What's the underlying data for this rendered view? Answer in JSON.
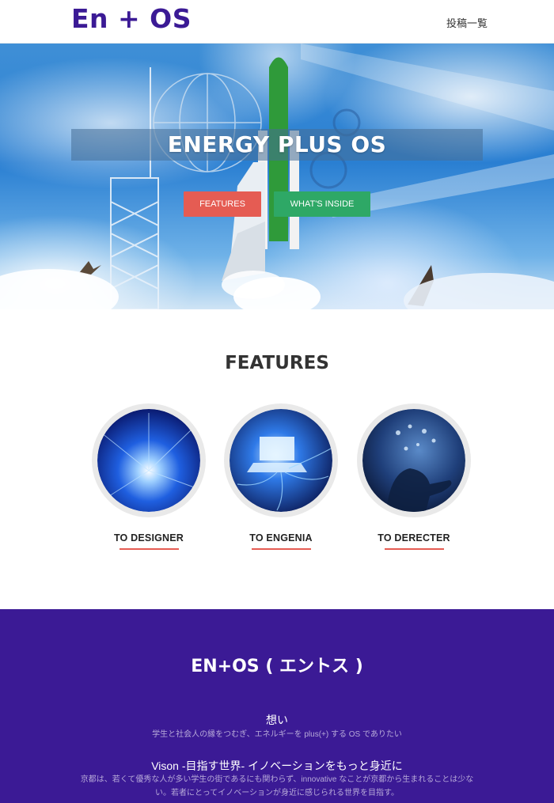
{
  "nav": {
    "brand": "En + OS",
    "link_posts": "投稿一覧"
  },
  "hero": {
    "title": "ENERGY PLUS OS",
    "btn_features": "FEATURES",
    "btn_inside": "WHAT'S INSIDE"
  },
  "features": {
    "title": "FEATURES",
    "items": [
      {
        "label": "TO DESIGNER"
      },
      {
        "label": "TO ENGENIA"
      },
      {
        "label": "TO DERECTER"
      }
    ]
  },
  "about": {
    "title": "EN+OS ( エントス )",
    "sections": [
      {
        "heading": "想い",
        "text": "学生と社会人の縁をつむぎ、エネルギーを plus(+) する OS でありたい"
      },
      {
        "heading": "Vison -目指す世界- イノベーションをもっと身近に",
        "text": "京都は、若くて優秀な人が多い学生の街であるにも関わらず、innovative なことが京都から生まれることは少ない。若者にとってイノベーションが身近に感じられる世界を目指す。"
      }
    ]
  },
  "colors": {
    "brand": "#3b1a95",
    "accent_red": "#e55c53",
    "accent_green": "#2ea866"
  }
}
